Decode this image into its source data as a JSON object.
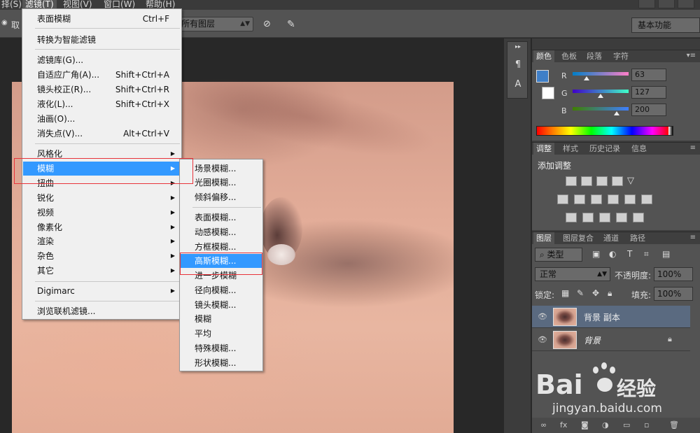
{
  "menubar": {
    "items": [
      {
        "label": "择(S)"
      },
      {
        "label": "滤镜(T)"
      },
      {
        "label": "视图(V)"
      },
      {
        "label": "窗口(W)"
      },
      {
        "label": "帮助(H)"
      }
    ]
  },
  "optionsbar": {
    "sample_partial": "取",
    "layers_select": "所有图层",
    "workspace": "基本功能"
  },
  "filter_menu": {
    "items": [
      {
        "label": "表面模糊",
        "shortcut": "Ctrl+F"
      },
      {
        "label": "转换为智能滤镜",
        "shortcut": ""
      },
      {
        "label": "滤镜库(G)...",
        "shortcut": ""
      },
      {
        "label": "自适应广角(A)...",
        "shortcut": "Shift+Ctrl+A"
      },
      {
        "label": "镜头校正(R)...",
        "shortcut": "Shift+Ctrl+R"
      },
      {
        "label": "液化(L)...",
        "shortcut": "Shift+Ctrl+X"
      },
      {
        "label": "油画(O)...",
        "shortcut": ""
      },
      {
        "label": "消失点(V)...",
        "shortcut": "Alt+Ctrl+V"
      },
      {
        "label": "风格化",
        "shortcut": ""
      },
      {
        "label": "模糊",
        "shortcut": ""
      },
      {
        "label": "扭曲",
        "shortcut": ""
      },
      {
        "label": "锐化",
        "shortcut": ""
      },
      {
        "label": "视频",
        "shortcut": ""
      },
      {
        "label": "像素化",
        "shortcut": ""
      },
      {
        "label": "渲染",
        "shortcut": ""
      },
      {
        "label": "杂色",
        "shortcut": ""
      },
      {
        "label": "其它",
        "shortcut": ""
      },
      {
        "label": "Digimarc",
        "shortcut": ""
      },
      {
        "label": "浏览联机滤镜...",
        "shortcut": ""
      }
    ]
  },
  "blur_submenu": {
    "items": [
      {
        "label": "场景模糊..."
      },
      {
        "label": "光圈模糊..."
      },
      {
        "label": "倾斜偏移..."
      },
      {
        "label": "表面模糊..."
      },
      {
        "label": "动感模糊..."
      },
      {
        "label": "方框模糊..."
      },
      {
        "label": "高斯模糊..."
      },
      {
        "label": "进一步模糊"
      },
      {
        "label": "径向模糊..."
      },
      {
        "label": "镜头模糊..."
      },
      {
        "label": "模糊"
      },
      {
        "label": "平均"
      },
      {
        "label": "特殊模糊..."
      },
      {
        "label": "形状模糊..."
      }
    ]
  },
  "color_panel": {
    "tabs": [
      "颜色",
      "色板",
      "段落",
      "字符"
    ],
    "r_label": "R",
    "g_label": "G",
    "b_label": "B",
    "r_value": "63",
    "g_value": "127",
    "b_value": "200",
    "foreground_color": "#3f7fc8"
  },
  "adjust_panel": {
    "tabs": [
      "调整",
      "样式",
      "历史记录",
      "信息"
    ],
    "title": "添加调整"
  },
  "layers_panel": {
    "tabs": [
      "图层",
      "图层复合",
      "通道",
      "路径"
    ],
    "filter_kind": "类型",
    "blend_mode": "正常",
    "opacity_label": "不透明度:",
    "opacity_value": "100%",
    "lock_label": "锁定:",
    "fill_label": "填充:",
    "fill_value": "100%",
    "layers": [
      {
        "name": "背景 副本",
        "selected": true
      },
      {
        "name": "背景",
        "selected": false
      }
    ]
  },
  "watermark": {
    "brand": "Bai",
    "brand_cn": "经验",
    "url": "jingyan.baidu.com"
  }
}
